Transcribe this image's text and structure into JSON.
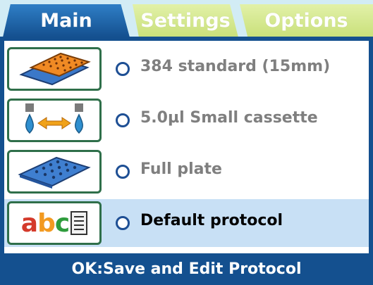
{
  "tabs": [
    {
      "label": "Main",
      "active": true
    },
    {
      "label": "Settings",
      "active": false
    },
    {
      "label": "Options",
      "active": false
    }
  ],
  "rows": [
    {
      "label": "384 standard (15mm)",
      "icon": "plate-384-icon",
      "selected": false
    },
    {
      "label": "5.0µl Small cassette",
      "icon": "cassette-dispense-icon",
      "selected": false
    },
    {
      "label": "Full plate",
      "icon": "full-plate-icon",
      "selected": false
    },
    {
      "label": "Default protocol",
      "icon": "abc-protocol-icon",
      "selected": true
    }
  ],
  "abc_text": {
    "a": "a",
    "b": "b",
    "c": "c"
  },
  "footer": {
    "label": "OK:Save and Edit Protocol"
  },
  "colors": {
    "frame_blue": "#14508f",
    "inactive_tab": "#c9e07a",
    "selected_row": "#c8e0f5",
    "radio": "#1e4f94"
  }
}
